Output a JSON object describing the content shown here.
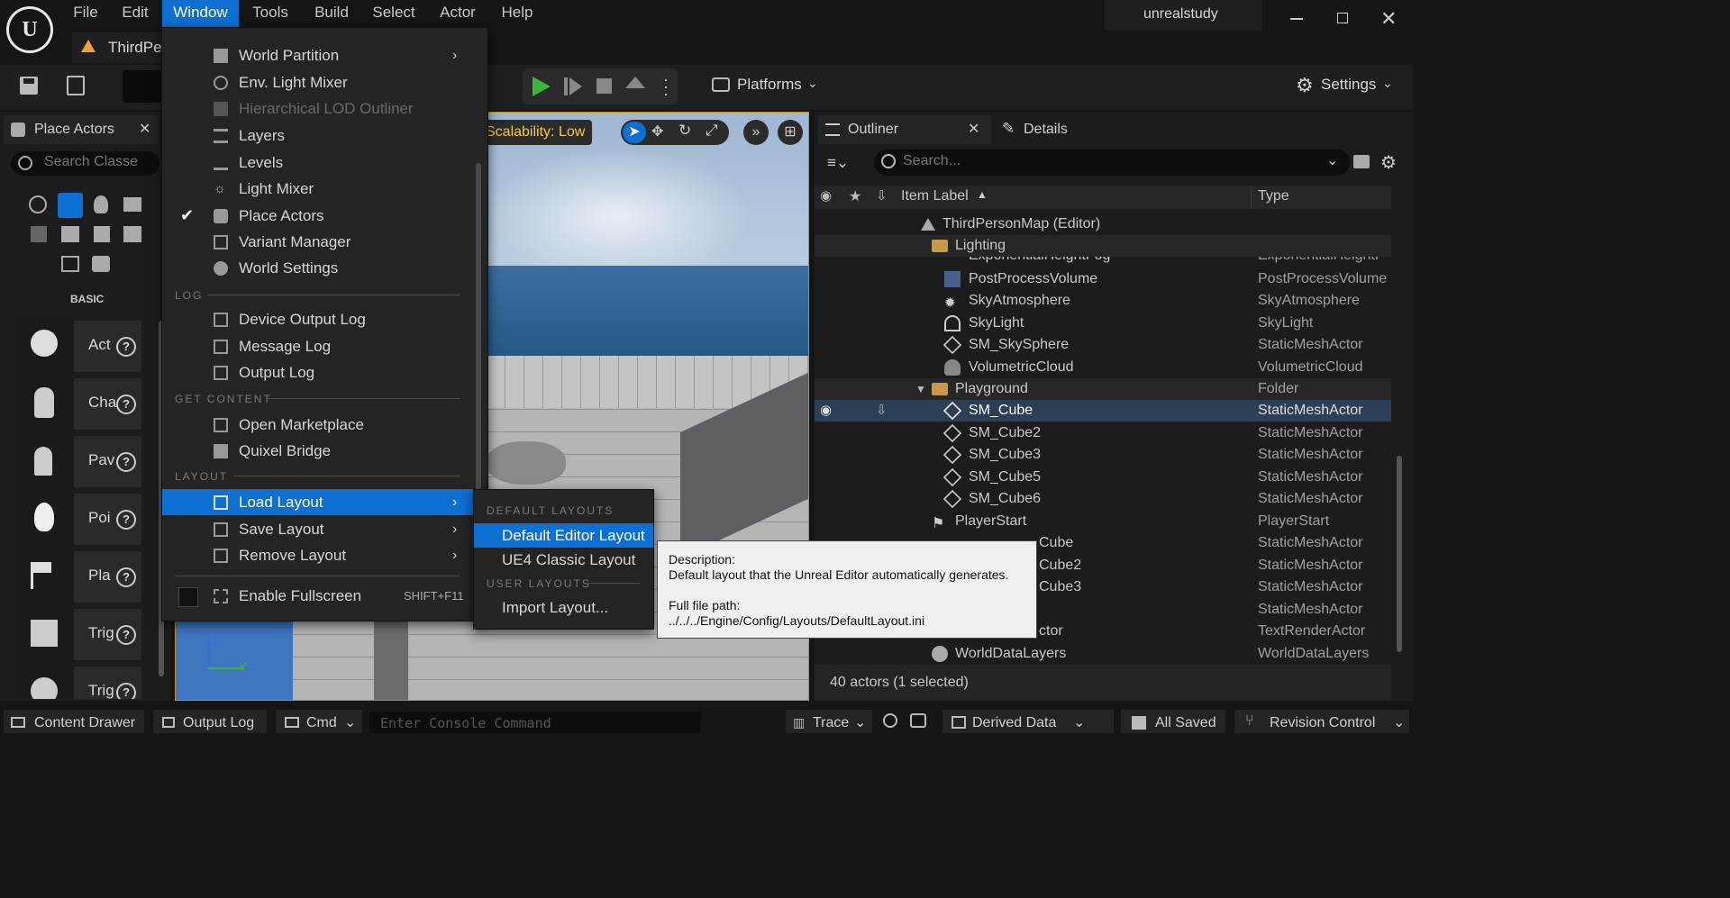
{
  "titlebar": {
    "project_name": "unrealstudy",
    "level_tab": "ThirdPer"
  },
  "menubar": [
    "File",
    "Edit",
    "Window",
    "Tools",
    "Build",
    "Select",
    "Actor",
    "Help"
  ],
  "toolbar": {
    "platforms": "Platforms",
    "settings": "Settings"
  },
  "place_actors": {
    "tab_label": "Place Actors",
    "search_placeholder": "Search Classe",
    "category": "BASIC",
    "items": [
      {
        "label": "Act",
        "icon": "sphere-actor-icon"
      },
      {
        "label": "Cha",
        "icon": "character-icon"
      },
      {
        "label": "Pav",
        "icon": "pawn-icon"
      },
      {
        "label": "Poi",
        "icon": "point-light-icon"
      },
      {
        "label": "Pla",
        "icon": "player-start-icon"
      },
      {
        "label": "Trig",
        "icon": "trigger-box-icon"
      },
      {
        "label": "Trig",
        "icon": "trigger-sphere-icon"
      }
    ]
  },
  "viewport": {
    "scalability": "Scalability: Low"
  },
  "window_menu": {
    "items_top": [
      {
        "label": "World Partition",
        "icon": "world-partition-icon",
        "submenu": true
      },
      {
        "label": "Env. Light Mixer",
        "icon": "env-light-mixer-icon"
      },
      {
        "label": "Hierarchical LOD Outliner",
        "icon": "hlod-icon",
        "disabled": true
      },
      {
        "label": "Layers",
        "icon": "layers-icon"
      },
      {
        "label": "Levels",
        "icon": "levels-icon"
      },
      {
        "label": "Light Mixer",
        "icon": "light-mixer-icon"
      },
      {
        "label": "Place Actors",
        "icon": "place-actors-icon",
        "checked": true
      },
      {
        "label": "Variant Manager",
        "icon": "variant-manager-icon"
      },
      {
        "label": "World Settings",
        "icon": "world-settings-icon"
      }
    ],
    "section_log": "LOG",
    "items_log": [
      {
        "label": "Device Output Log",
        "icon": "log-icon"
      },
      {
        "label": "Message Log",
        "icon": "log-icon"
      },
      {
        "label": "Output Log",
        "icon": "log-icon"
      }
    ],
    "section_content": "GET CONTENT",
    "items_content": [
      {
        "label": "Open Marketplace",
        "icon": "marketplace-icon"
      },
      {
        "label": "Quixel Bridge",
        "icon": "bridge-icon"
      }
    ],
    "section_layout": "LAYOUT",
    "items_layout": [
      {
        "label": "Load Layout",
        "icon": "layout-icon",
        "submenu": true,
        "highlighted": true
      },
      {
        "label": "Save Layout",
        "icon": "layout-icon",
        "submenu": true
      },
      {
        "label": "Remove Layout",
        "icon": "layout-remove-icon",
        "submenu": true
      }
    ],
    "fullscreen": {
      "label": "Enable Fullscreen",
      "shortcut": "SHIFT+F11"
    }
  },
  "load_layout_submenu": {
    "section_default": "DEFAULT LAYOUTS",
    "default_editor": "Default Editor Layout",
    "ue4_classic": "UE4 Classic Layout",
    "section_user": "USER LAYOUTS",
    "import": "Import Layout..."
  },
  "tooltip": {
    "desc_label": "Description:",
    "desc_text": "Default layout that the Unreal Editor automatically generates.",
    "path_label": "Full file path:",
    "path_text": "../../../Engine/Config/Layouts/DefaultLayout.ini"
  },
  "outliner": {
    "tab_label": "Outliner",
    "details_tab": "Details",
    "search_placeholder": "Search...",
    "col_label": "Item Label",
    "col_type": "Type",
    "map_row": "ThirdPersonMap (Editor)",
    "lighting_folder": "Lighting",
    "rows": [
      {
        "label": "ExponentialHeightFog",
        "type": "ExponentialHeightF",
        "icon": "fog-icon"
      },
      {
        "label": "PostProcessVolume",
        "type": "PostProcessVolume",
        "icon": "volume-icon"
      },
      {
        "label": "SkyAtmosphere",
        "type": "SkyAtmosphere",
        "icon": "sky-atmosphere-icon"
      },
      {
        "label": "SkyLight",
        "type": "SkyLight",
        "icon": "skylight-icon"
      },
      {
        "label": "SM_SkySphere",
        "type": "StaticMeshActor",
        "icon": "static-mesh-icon"
      },
      {
        "label": "VolumetricCloud",
        "type": "VolumetricCloud",
        "icon": "cloud-icon"
      }
    ],
    "playground_folder": {
      "label": "Playground",
      "type": "Folder"
    },
    "playground_rows": [
      {
        "label": "SM_Cube",
        "type": "StaticMeshActor",
        "selected": true
      },
      {
        "label": "SM_Cube2",
        "type": "StaticMeshActor"
      },
      {
        "label": "SM_Cube3",
        "type": "StaticMeshActor"
      },
      {
        "label": "SM_Cube5",
        "type": "StaticMeshActor"
      },
      {
        "label": "SM_Cube6",
        "type": "StaticMeshActor"
      }
    ],
    "player_start": {
      "label": "PlayerStart",
      "type": "PlayerStart"
    },
    "partial_rows": [
      {
        "label": "Cube",
        "type": "StaticMeshActor"
      },
      {
        "label": "Cube2",
        "type": "StaticMeshActor"
      },
      {
        "label": "Cube3",
        "type": "StaticMeshActor"
      },
      {
        "label": "",
        "type": "StaticMeshActor"
      },
      {
        "label": "ctor",
        "type": "TextRenderActor"
      }
    ],
    "world_data_layers": {
      "label": "WorldDataLayers",
      "type": "WorldDataLayers"
    },
    "status": "40 actors (1 selected)"
  },
  "bottombar": {
    "content_drawer": "Content Drawer",
    "output_log": "Output Log",
    "cmd": "Cmd",
    "console_placeholder": "Enter Console Command",
    "trace": "Trace",
    "derived_data": "Derived Data",
    "all_saved": "All Saved",
    "revision_control": "Revision Control"
  },
  "colors": {
    "accent": "#0e6fd3",
    "selected_row": "#2c3f55",
    "scalability": "#f2c94c",
    "play_green": "#3ab83a"
  }
}
